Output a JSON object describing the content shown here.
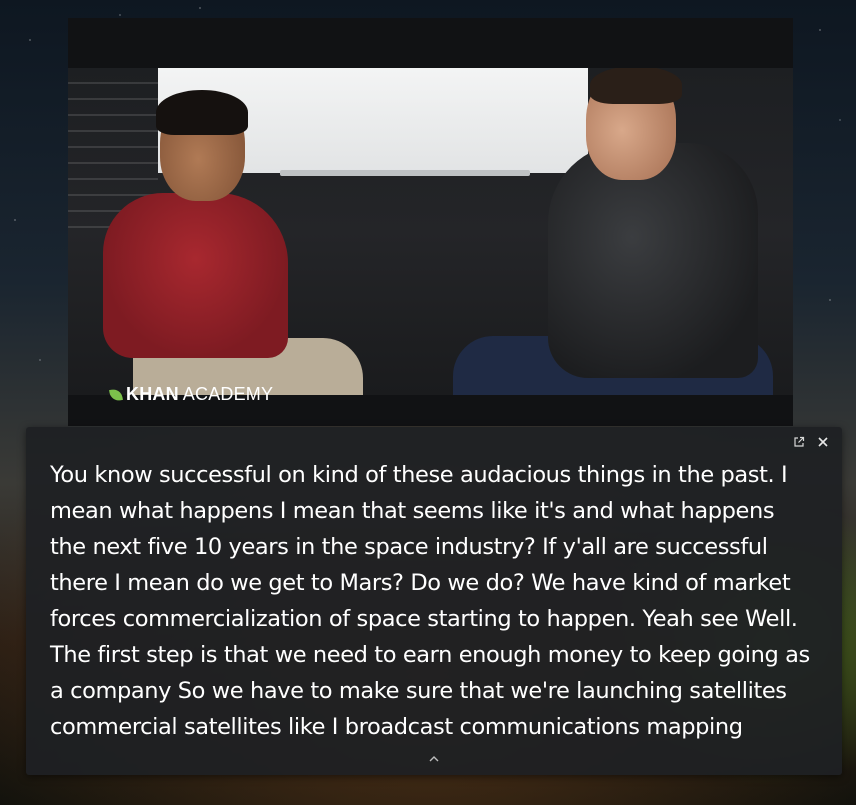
{
  "video": {
    "logo_bold": "KHAN",
    "logo_regular": "ACADEMY"
  },
  "caption_panel": {
    "popout_icon": "popout-icon",
    "close_icon": "close-icon",
    "caption_text": "You know successful on kind of these audacious things in the past. I mean what happens I mean that seems like it's and what happens the next five 10 years in the space industry? If y'all are successful there I mean do we get to Mars? Do we do? We have kind of market forces commercialization of space starting to happen. Yeah see Well. The first step is that we need to earn enough money to keep going as a company So we have to make sure that we're launching satellites commercial satellites like I broadcast communications mapping",
    "expand_icon": "chevron-up-icon"
  },
  "colors": {
    "panel_background": "#1e2023",
    "text": "#ffffff",
    "logo_leaf": "#7cc04b"
  }
}
